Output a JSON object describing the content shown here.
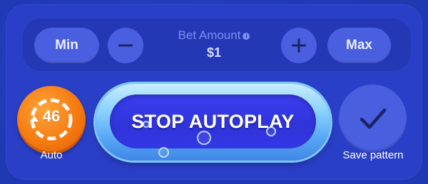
{
  "bet": {
    "min_label": "Min",
    "max_label": "Max",
    "amount_label": "Bet Amount",
    "info_glyph": "i",
    "amount_value": "$1",
    "decrease_icon": "minus-icon",
    "increase_icon": "plus-icon"
  },
  "auto": {
    "count": "46",
    "label": "Auto",
    "icon": "autoplay-refresh-icon"
  },
  "autoplay": {
    "button_label": "STOP AUTOPLAY"
  },
  "save": {
    "label": "Save pattern",
    "icon": "checkmark-icon"
  },
  "colors": {
    "background": "#1f39b3",
    "panel": "#2a3fc7",
    "pill": "#4a5ee0",
    "auto_orange": "#f57a10",
    "stop_inner": "#3a3ef0",
    "stop_rim": "#8cd2ff"
  }
}
